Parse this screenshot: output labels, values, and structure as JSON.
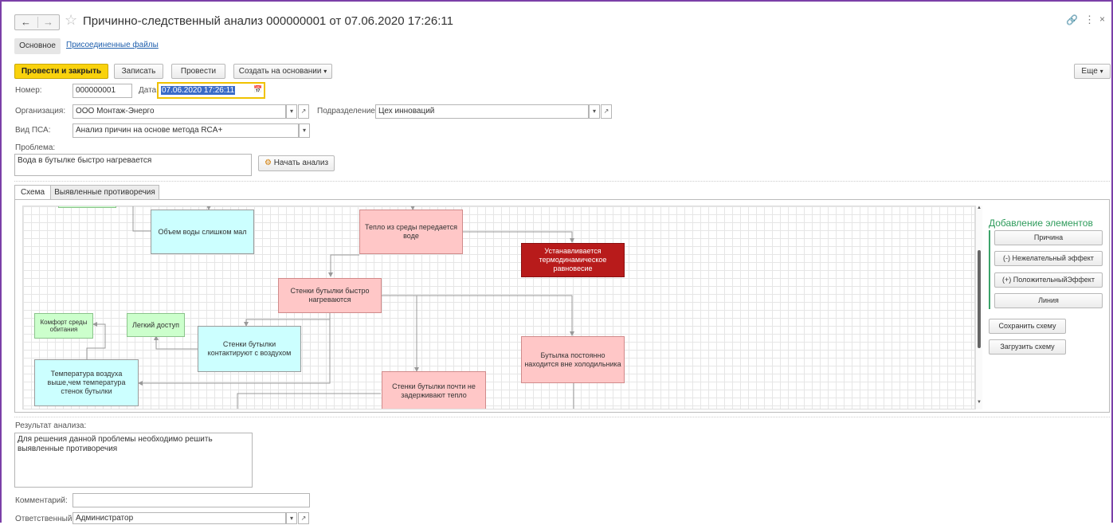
{
  "window": {
    "title": "Причинно-следственный анализ 000000001 от 07.06.2020 17:26:11",
    "tabs": [
      "Основное",
      "Присоединенные файлы"
    ]
  },
  "toolbar": {
    "post_close": "Провести и закрыть",
    "save": "Записать",
    "post": "Провести",
    "create_based": "Создать на основании",
    "more": "Еще"
  },
  "form": {
    "number_label": "Номер:",
    "number_value": "000000001",
    "date_label": "Дата:",
    "date_value": "07.06.2020 17:26:11",
    "org_label": "Организация:",
    "org_value": "ООО Монтаж-Энерго",
    "dept_label": "Подразделение:",
    "dept_value": "Цех инноваций",
    "kind_label": "Вид ПСА:",
    "kind_value": "Анализ причин на основе метода RCA+",
    "problem_label": "Проблема:",
    "problem_value": "Вода в бутылке быстро нагревается",
    "start_analysis": "Начать анализ",
    "result_label": "Результат анализа:",
    "result_value": "Для решения данной проблемы необходимо решить выявленные противоречия",
    "comment_label": "Комментарий:",
    "comment_value": "",
    "responsible_label": "Ответственный:",
    "responsible_value": "Администратор"
  },
  "inner_tabs": [
    "Схема",
    "Выявленные противоречия"
  ],
  "diagram": {
    "nodes": {
      "volume_small": "Объем воды слишком мал",
      "heat_transfer": "Тепло из среды передается воде",
      "equilibrium": "Устанавливается термодинамическое равновесие",
      "walls_heat": "Стенки бутылки быстро нагреваются",
      "comfort": "Комфорт среды обитания",
      "easy_access": "Легкий доступ",
      "walls_air": "Стенки бутылки контактируют с воздухом",
      "out_fridge": "Бутылка постоянно находится вне холодильника",
      "air_temp": "Температура воздуха выше,чем температура стенок бутылки",
      "walls_no_hold": "Стенки бутылки почти не задерживают тепло"
    }
  },
  "side_panel": {
    "title": "Добавление элементов",
    "cause": "Причина",
    "neg_effect": "(-) Нежелательный эффект",
    "pos_effect": "(+) ПоложительныйЭффект",
    "line": "Линия",
    "save_scheme": "Сохранить схему",
    "load_scheme": "Загрузить схему"
  }
}
